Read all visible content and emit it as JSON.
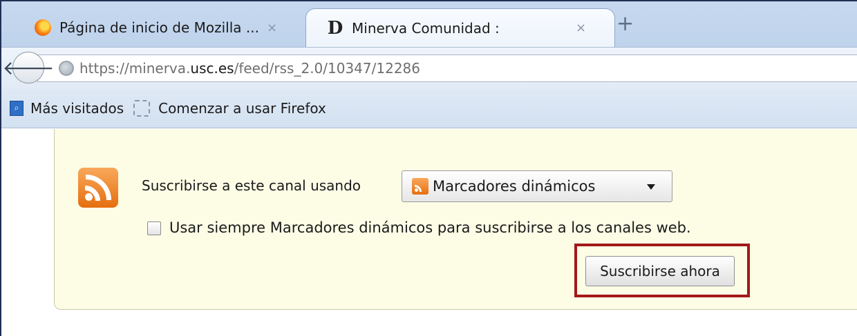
{
  "tabs": [
    {
      "title": "Página de inicio de Mozilla ...",
      "close": "×",
      "icon": "firefox-icon",
      "active": false
    },
    {
      "title": "Minerva Comunidad :",
      "close": "×",
      "icon": "d-icon",
      "icon_glyph": "D",
      "active": true
    }
  ],
  "new_tab": "+",
  "nav": {
    "back_glyph": "🡐",
    "url_prefix": "https://minerva.",
    "url_domain": "usc.es",
    "url_suffix": "/feed/rss_2.0/10347/12286"
  },
  "bookmarks": [
    {
      "label": "Más visitados",
      "icon": "most-visited-icon"
    },
    {
      "label": "Comenzar a usar Firefox",
      "icon": "folder-icon"
    }
  ],
  "feed": {
    "subscribe_label": "Suscribirse a este canal usando",
    "reader_selected": "Marcadores dinámicos",
    "always_use_label": "Usar siempre Marcadores dinámicos para suscribirse a los canales web.",
    "always_use_checked": false,
    "subscribe_button": "Suscribirse ahora",
    "highlight_color": "#a31818"
  }
}
